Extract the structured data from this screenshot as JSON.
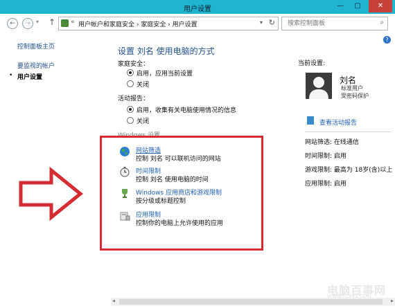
{
  "window": {
    "title": "用户设置",
    "minimize": "—",
    "maximize": "▢",
    "close": "✕"
  },
  "nav": {
    "back": "←",
    "forward": "→",
    "up": "↑",
    "breadcrumb": "用户帐户和家庭安全 › 家庭安全 › 用户设置",
    "prefix": "«",
    "search_placeholder": "搜索控制面板"
  },
  "sidebar": {
    "home": "控制面板主页",
    "monitored": "要监视的帐户",
    "current": "用户设置"
  },
  "main": {
    "heading": "设置 刘名 使用电脑的方式",
    "family_safety": {
      "label": "家庭安全：",
      "options": [
        "启用，应用当前设置",
        "关闭"
      ],
      "selected": 0
    },
    "activity_report": {
      "label": "活动报告：",
      "options": [
        "启用，收集有关电脑使用情况的信息",
        "关闭"
      ],
      "selected": 0
    },
    "windows_settings_label": "Windows 设置",
    "settings": [
      {
        "title": "网站筛选",
        "desc": "控制 刘名 可以联机访问的网站",
        "icon": "globe-icon"
      },
      {
        "title": "时间限制",
        "desc": "控制 刘名 使用电脑的时间",
        "icon": "clock-icon"
      },
      {
        "title": "Windows 应用商店和游戏限制",
        "desc": "按分级或标题控制",
        "icon": "trophy-icon"
      },
      {
        "title": "应用限制",
        "desc": "控制你的电脑上允许使用的应用",
        "icon": "app-restriction-icon"
      }
    ]
  },
  "current_settings": {
    "label": "当前设置:",
    "user_name": "刘名",
    "user_type": "标准用户",
    "password_status": "受密码保护",
    "report_link": "查看活动报告",
    "stats": [
      "网站筛选: 在线通信",
      "时间限制: 启用",
      "游戏限制: 最高为 18岁(含)以上",
      "应用限制: 启用"
    ]
  },
  "watermark": {
    "text": "电脑百事网",
    "url": "WWW.PC841.COM"
  },
  "colors": {
    "titlebar": "#1fb5d0",
    "highlight_box": "#d52b32",
    "link": "#1f5fb4"
  }
}
